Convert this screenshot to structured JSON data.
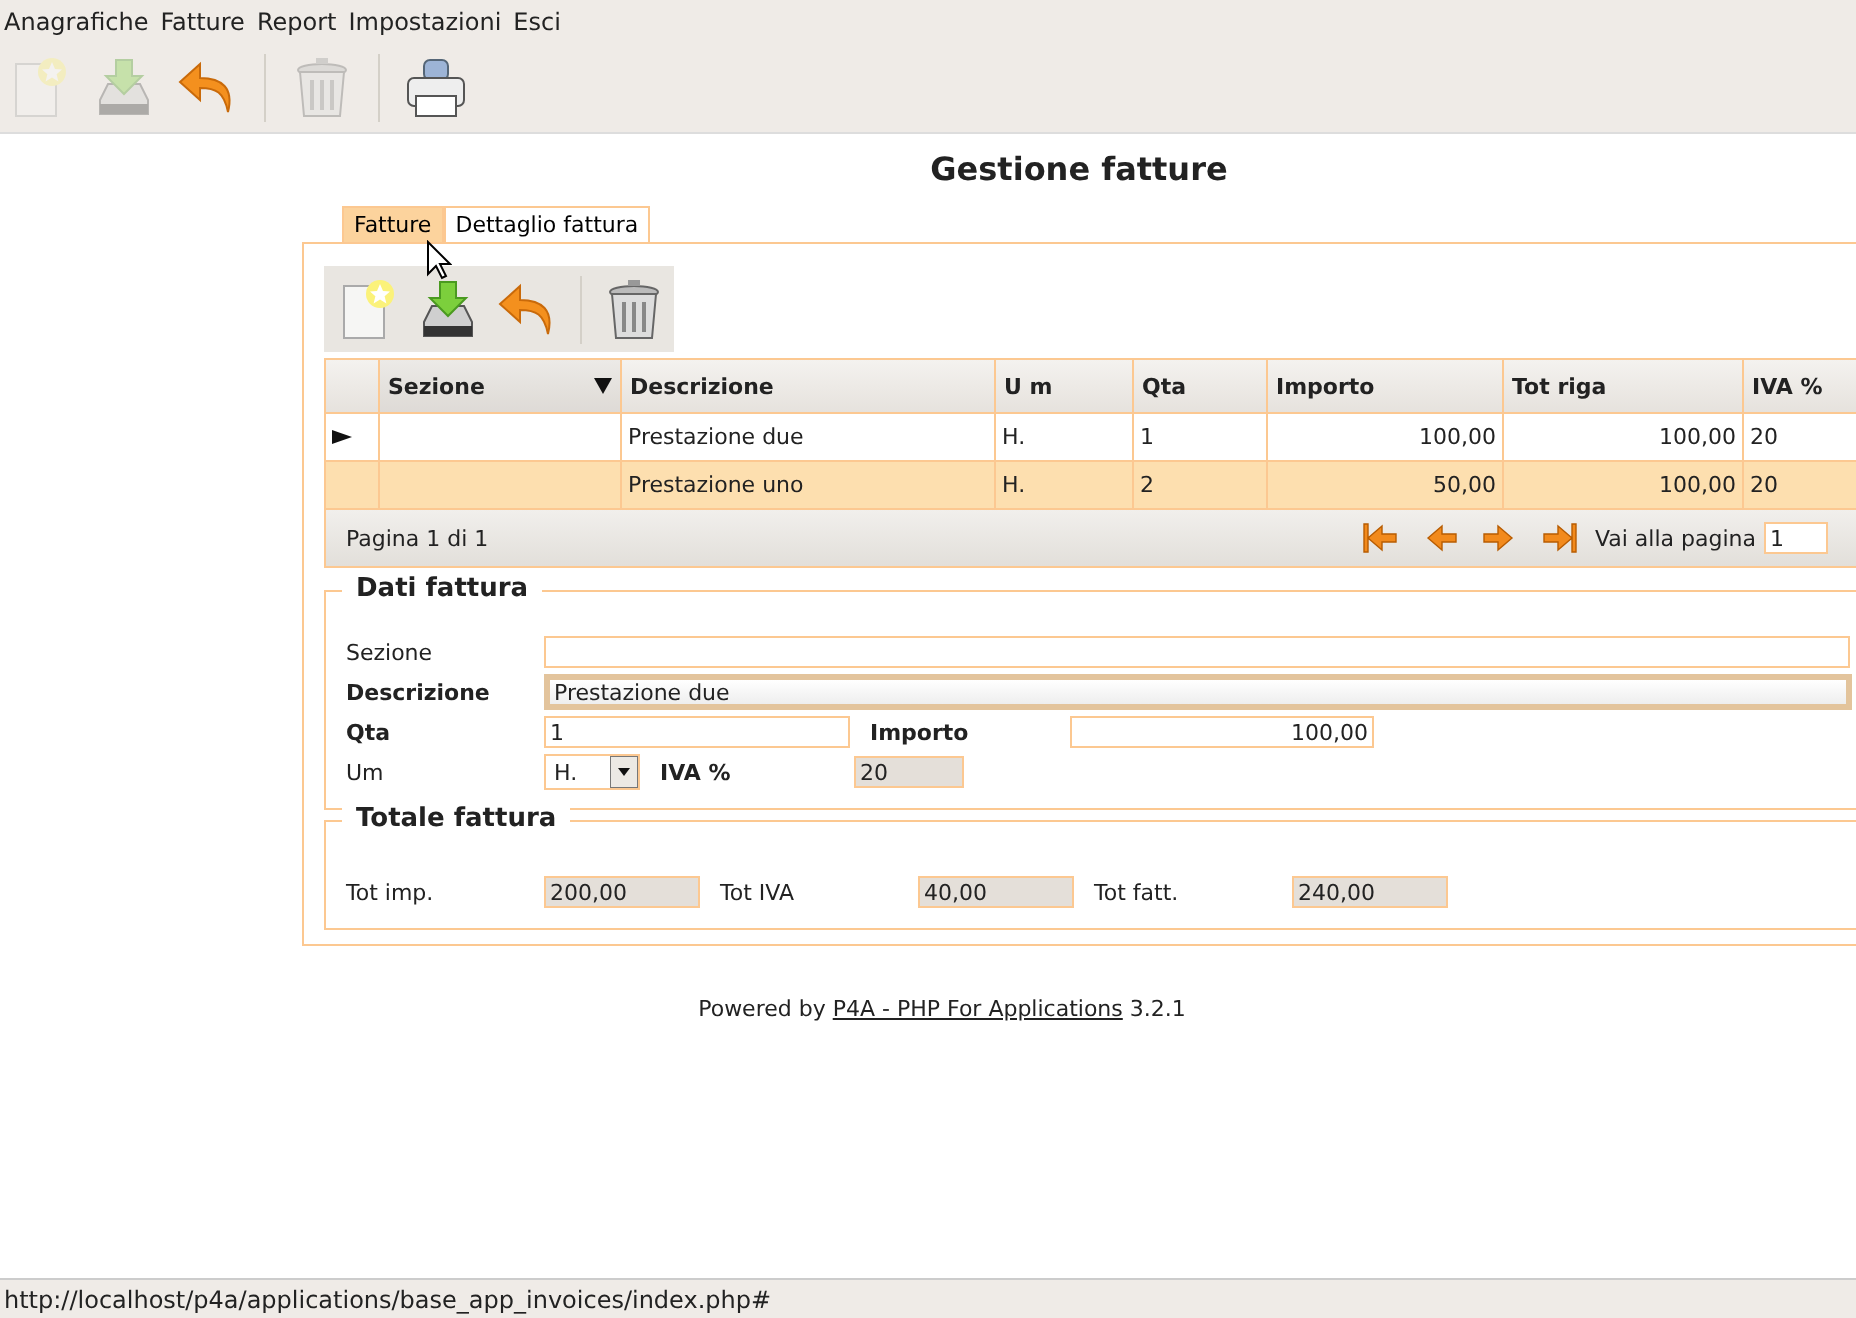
{
  "menu": [
    "Anagrafiche",
    "Fatture",
    "Report",
    "Impostazioni",
    "Esci"
  ],
  "toolbar": [
    {
      "kind": "new",
      "disabled": true
    },
    {
      "kind": "save",
      "disabled": true
    },
    {
      "kind": "undo",
      "disabled": false
    },
    {
      "kind": "separator"
    },
    {
      "kind": "delete",
      "disabled": true
    },
    {
      "kind": "separator"
    },
    {
      "kind": "print",
      "disabled": false
    }
  ],
  "title": "Gestione fatture",
  "tabs": [
    {
      "label": "Fatture",
      "selected": true
    },
    {
      "label": "Dettaglio fattura",
      "selected": false
    }
  ],
  "panel_toolbar": [
    {
      "kind": "new",
      "disabled": false
    },
    {
      "kind": "save",
      "disabled": false
    },
    {
      "kind": "undo",
      "disabled": false
    },
    {
      "kind": "separator"
    },
    {
      "kind": "delete",
      "disabled": false
    }
  ],
  "table": {
    "columns": [
      {
        "label": "Sezione",
        "sorted": true
      },
      {
        "label": "Descrizione",
        "sorted": false
      },
      {
        "label": "U m",
        "sorted": false
      },
      {
        "label": "Qta",
        "sorted": false
      },
      {
        "label": "Importo",
        "sorted": false
      },
      {
        "label": "Tot riga",
        "sorted": false
      },
      {
        "label": "IVA %",
        "sorted": false
      }
    ],
    "rows": [
      {
        "current": true,
        "selected": false,
        "cells": [
          "",
          "Prestazione due",
          "H.",
          "1",
          "100,00",
          "100,00",
          "20"
        ]
      },
      {
        "current": false,
        "selected": true,
        "cells": [
          "",
          "Prestazione uno",
          "H.",
          "2",
          "50,00",
          "100,00",
          "20"
        ]
      }
    ],
    "page_info": "Pagina 1 di 1",
    "goto_label": "Vai alla pagina",
    "goto_value": "1"
  },
  "dati": {
    "legend": "Dati fattura",
    "sezione": {
      "label": "Sezione"
    },
    "descrizione": {
      "label": "Descrizione",
      "value": "Prestazione due",
      "focused": true
    },
    "qta": {
      "label": "Qta",
      "value": "1"
    },
    "importo": {
      "label": "Importo",
      "value": "100,00"
    },
    "um": {
      "label": "Um",
      "value": "H."
    },
    "iva": {
      "label": "IVA %",
      "value": "20",
      "disabled": true
    }
  },
  "totale": {
    "legend": "Totale fattura",
    "items": [
      {
        "label": "Tot imp.",
        "value": "200,00"
      },
      {
        "label": "Tot IVA",
        "value": "40,00"
      },
      {
        "label": "Tot fatt.",
        "value": "240,00"
      }
    ]
  },
  "footer": {
    "prefix": "Powered by",
    "link": "P4A - PHP For Applications",
    "suffix": "3.2.1"
  },
  "status_bar": "http://localhost/p4a/applications/base_app_invoices/index.php#"
}
